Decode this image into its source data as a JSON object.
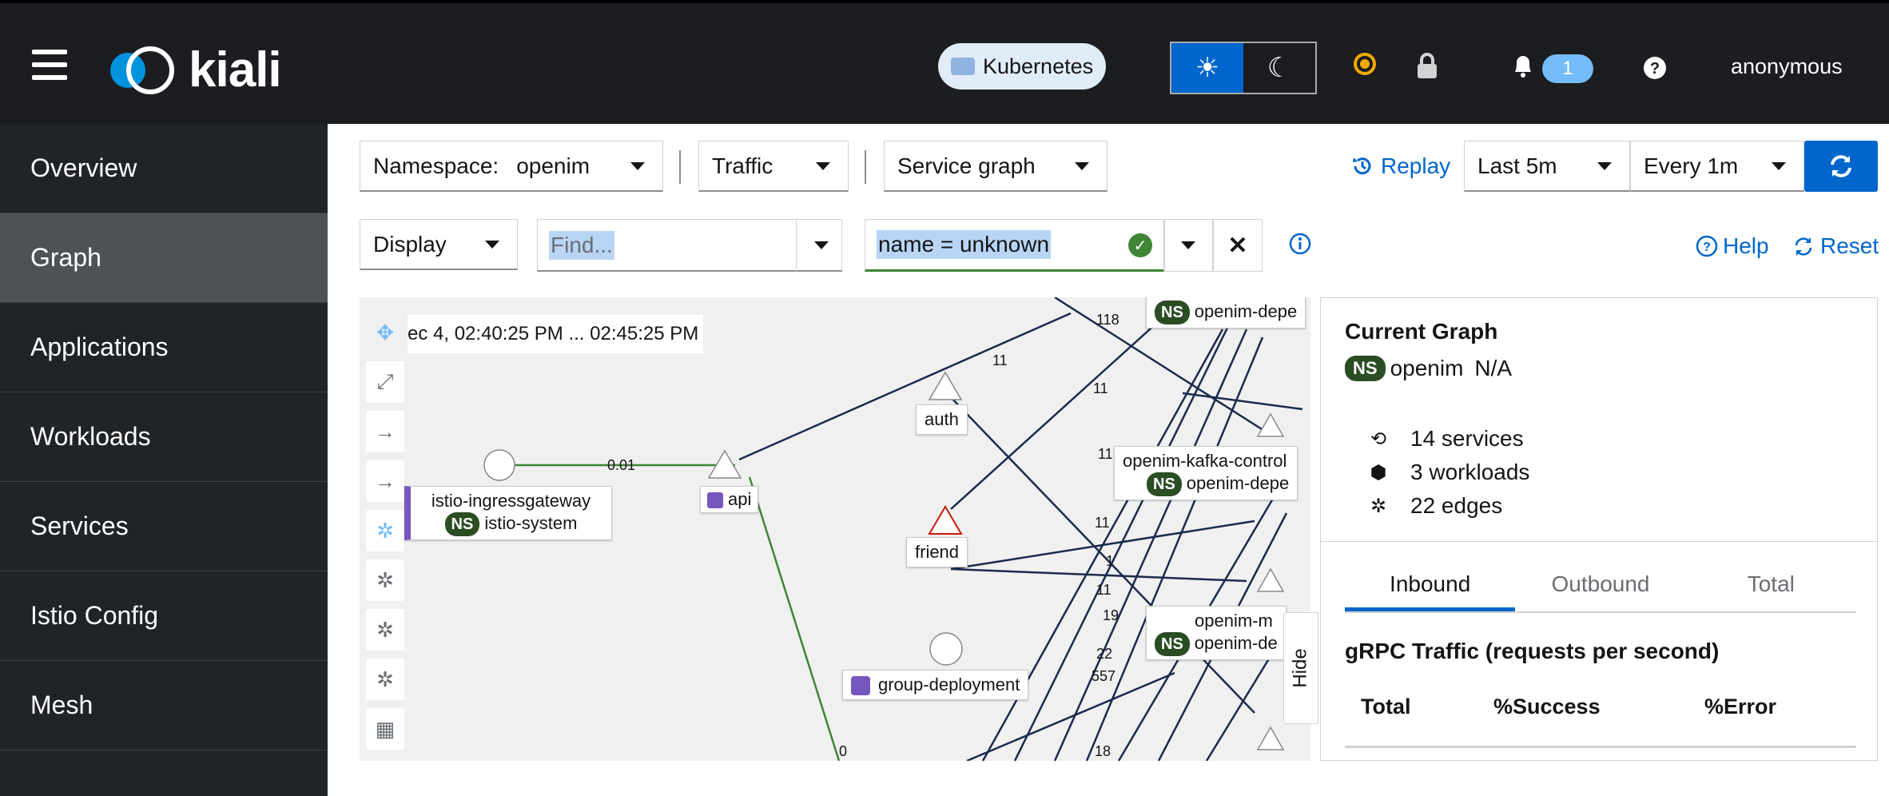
{
  "header": {
    "brand": "kiali",
    "cluster_label": "Kubernetes",
    "notifications_count": "1",
    "user": "anonymous"
  },
  "sidebar": {
    "items": [
      {
        "label": "Overview"
      },
      {
        "label": "Graph",
        "active": true
      },
      {
        "label": "Applications"
      },
      {
        "label": "Workloads"
      },
      {
        "label": "Services"
      },
      {
        "label": "Istio Config"
      },
      {
        "label": "Mesh"
      }
    ]
  },
  "toolbar": {
    "namespace_label": "Namespace:",
    "namespace_value": "openim",
    "traffic_label": "Traffic",
    "graph_type": "Service graph",
    "replay_label": "Replay",
    "duration": "Last 5m",
    "refresh_interval": "Every 1m",
    "display_label": "Display",
    "find_placeholder": "Find...",
    "hide_value": "name = unknown",
    "help_label": "Help",
    "reset_label": "Reset"
  },
  "graph": {
    "timestamp": "ec 4, 02:40:25 PM ... 02:45:25 PM",
    "nodes": {
      "ingress_name": "istio-ingressgateway",
      "ingress_ns": "istio-system",
      "api": "api",
      "auth": "auth",
      "friend": "friend",
      "group_deployment": "group-deployment",
      "kafka_control": "openim-kafka-control",
      "ns_dep_1": "openim-depe",
      "ns_dep_2": "openim-depe",
      "openim_m": "openim-m",
      "ns_dep_3": "openim-de"
    },
    "ns_badge": "NS",
    "edge_labels": {
      "e1": "0.01",
      "e2": "11",
      "e3": "118",
      "e4": "11",
      "e5": "11",
      "e6": "11",
      "e7": "1",
      "e8": "11",
      "e9": "19",
      "e10": "22",
      "e11": "557",
      "e12": "0",
      "e13": "18"
    },
    "hide_tab": "Hide"
  },
  "side_panel": {
    "title": "Current Graph",
    "namespace": "openim",
    "namespace_extra": "N/A",
    "services": "14 services",
    "workloads": "3 workloads",
    "edges": "22 edges",
    "tabs": [
      "Inbound",
      "Outbound",
      "Total"
    ],
    "section_title": "gRPC Traffic (requests per second)",
    "table_headers": [
      "Total",
      "%Success",
      "%Error"
    ]
  }
}
